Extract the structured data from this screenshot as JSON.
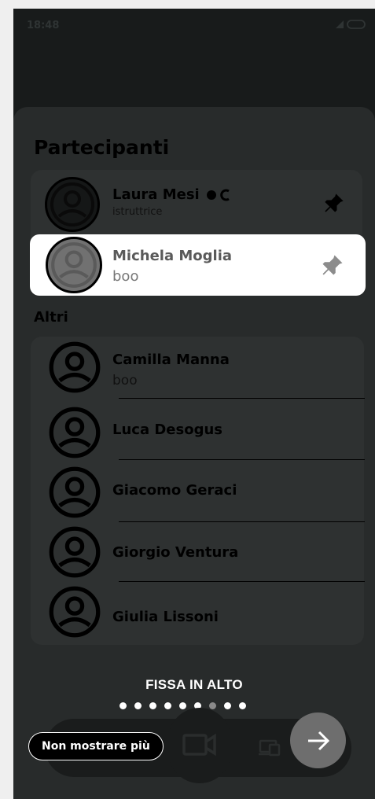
{
  "status_bar": {
    "time": "18:48"
  },
  "title": "Partecipanti",
  "pinned": [
    {
      "name": "Laura Mesi",
      "role": "istruttrice",
      "icon": "pin-icon"
    },
    {
      "name": "Michela Moglia",
      "role": "boo",
      "icon": "pin-icon"
    }
  ],
  "others_label": "Altri",
  "others": [
    {
      "name": "Camilla Manna",
      "sub": "boo"
    },
    {
      "name": "Luca Desogus",
      "sub": ""
    },
    {
      "name": "Giacomo Geraci",
      "sub": ""
    },
    {
      "name": "Giorgio Ventura",
      "sub": ""
    },
    {
      "name": "Giulia Lissoni",
      "sub": ""
    }
  ],
  "tip": {
    "title": "FISSA IN ALTO",
    "pages": 9,
    "current_page": 7
  },
  "dismiss_label": "Non mostrare più",
  "icons": {
    "camera": "video-camera-icon",
    "devices": "devices-icon",
    "next": "arrow-right-icon"
  },
  "colors": {
    "highlight": "#ffffff",
    "overlay": "#181b1b",
    "next_button": "#6e6e6e"
  }
}
